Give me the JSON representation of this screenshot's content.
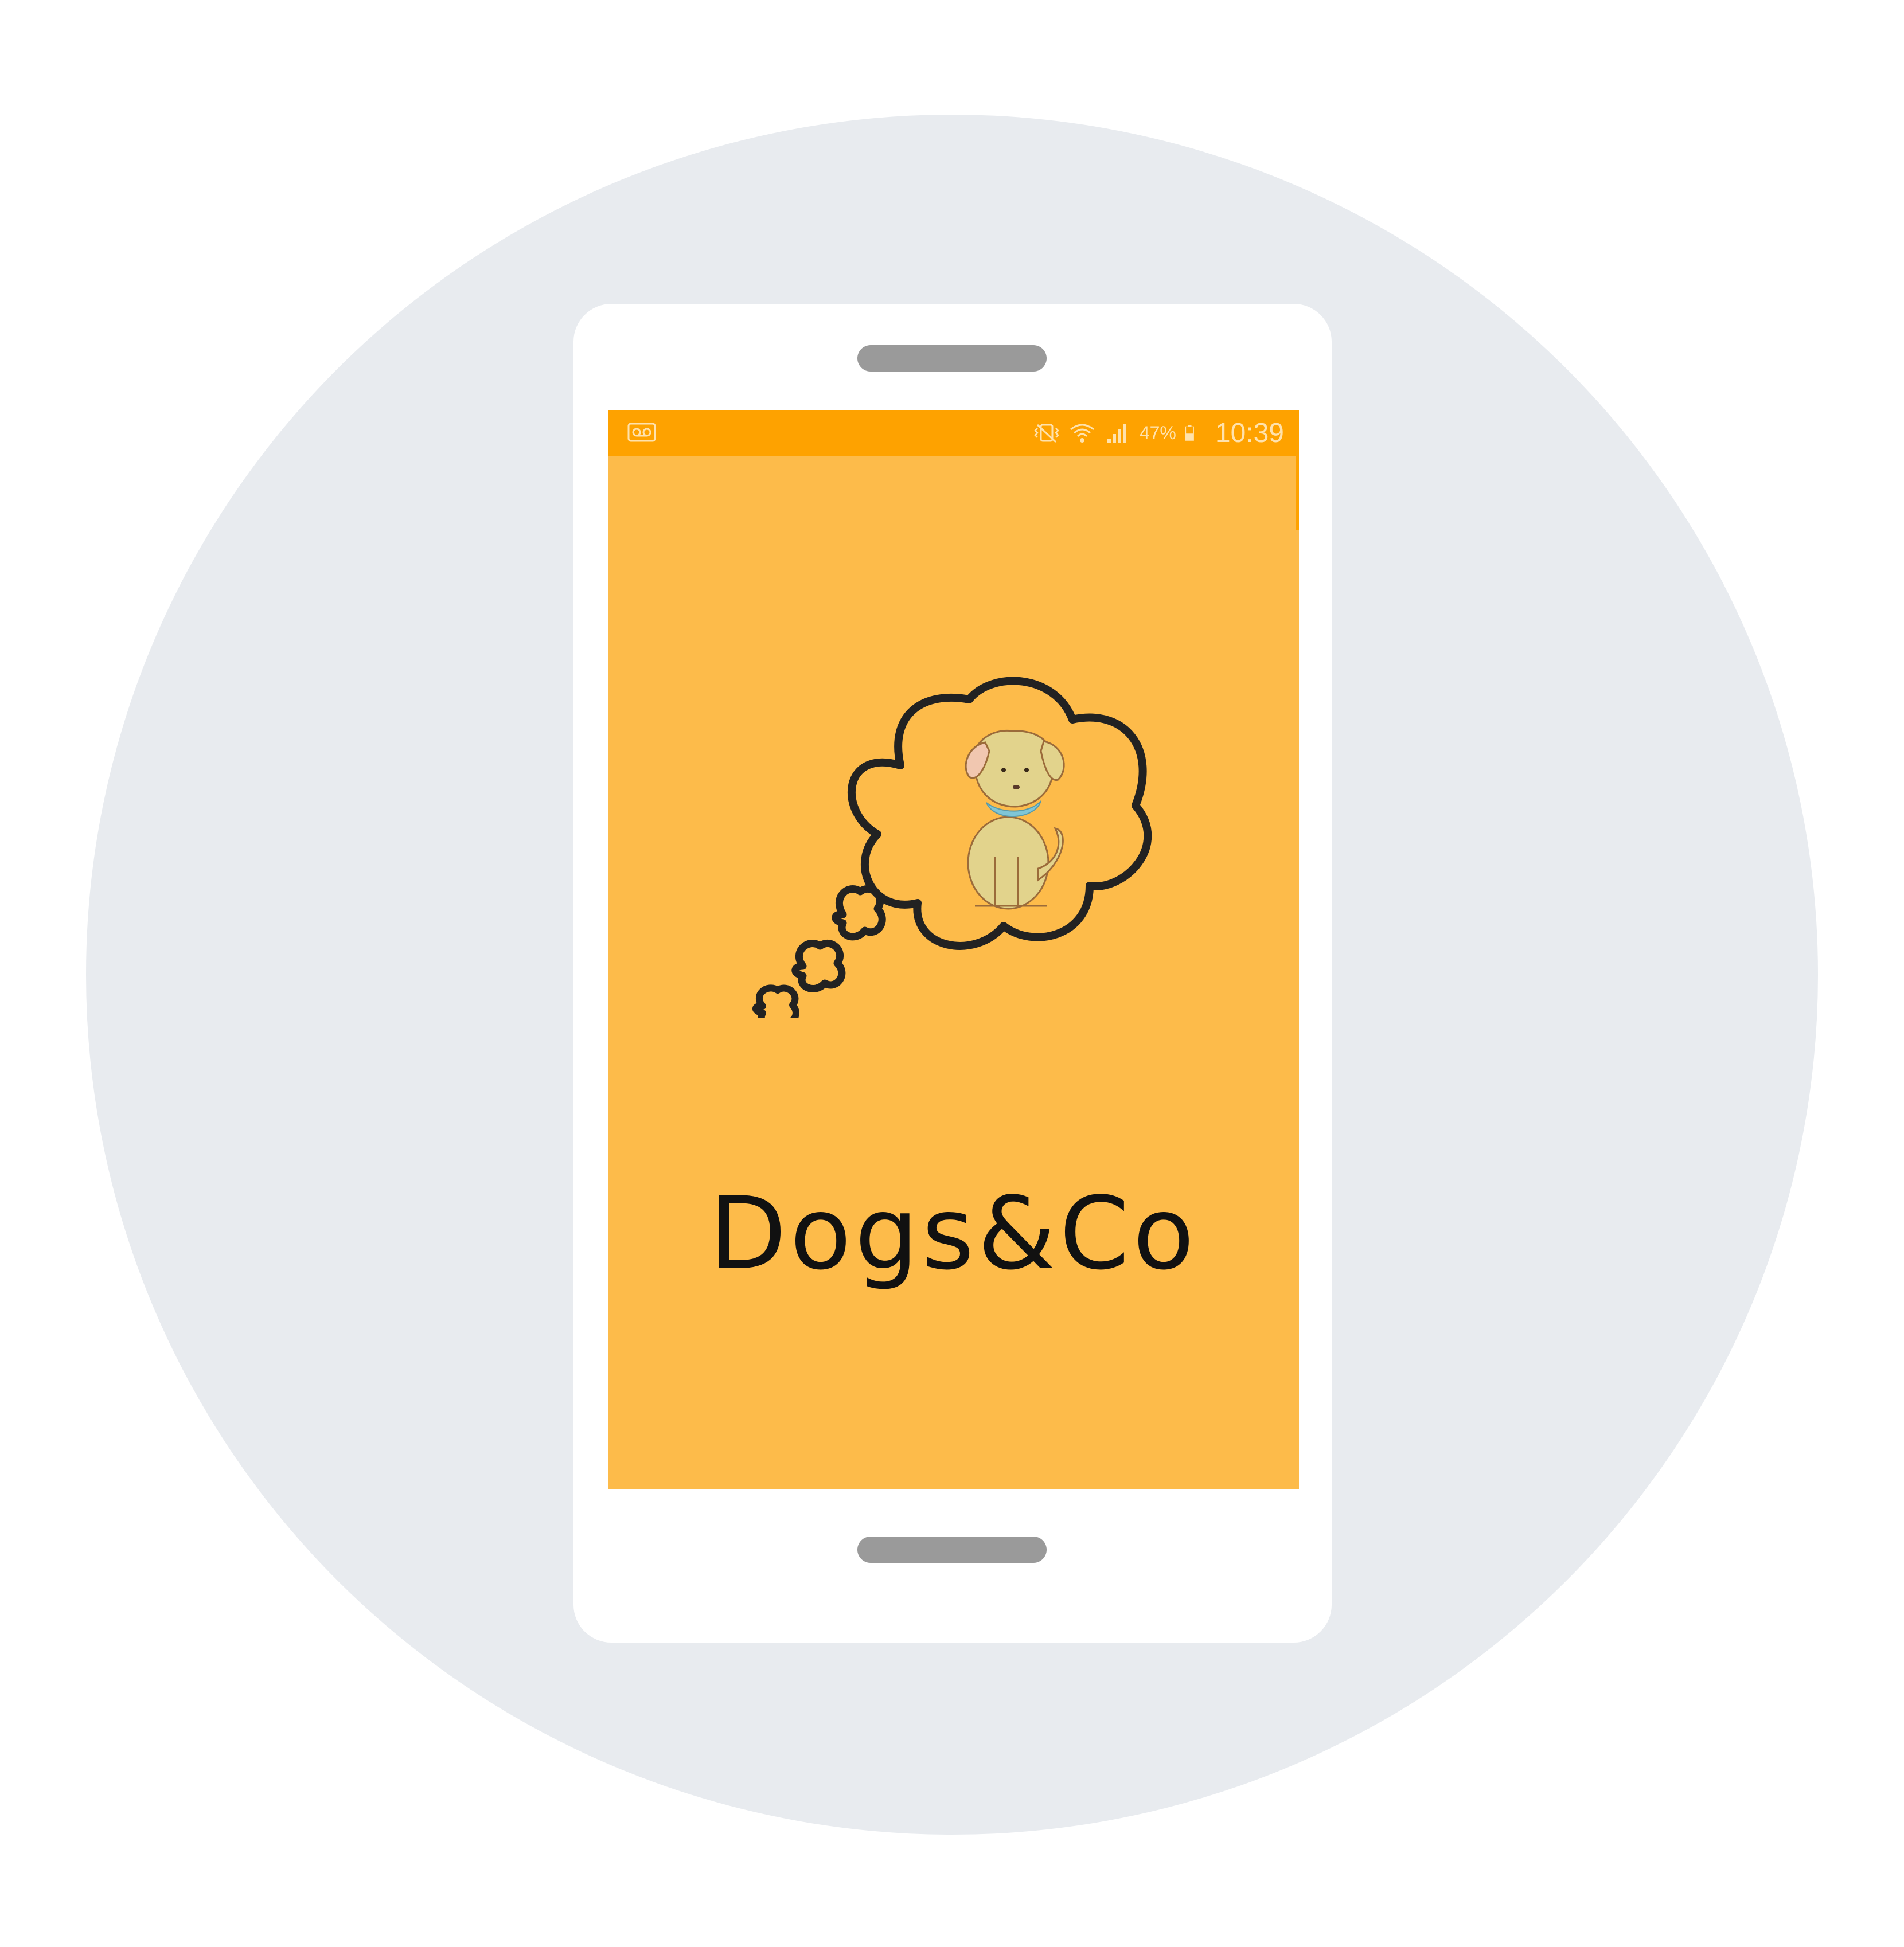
{
  "status_bar": {
    "battery_percent": "47%",
    "time": "10:39",
    "icons": [
      "voicemail-icon",
      "vibrate-icon",
      "wifi-icon",
      "signal-icon",
      "battery-icon"
    ]
  },
  "app": {
    "brand_name": "Dogs&Co"
  },
  "colors": {
    "backdrop": "#e8ebef",
    "status_bar": "#fea200",
    "screen_background": "#fdbb4a",
    "outline": "#222222"
  }
}
